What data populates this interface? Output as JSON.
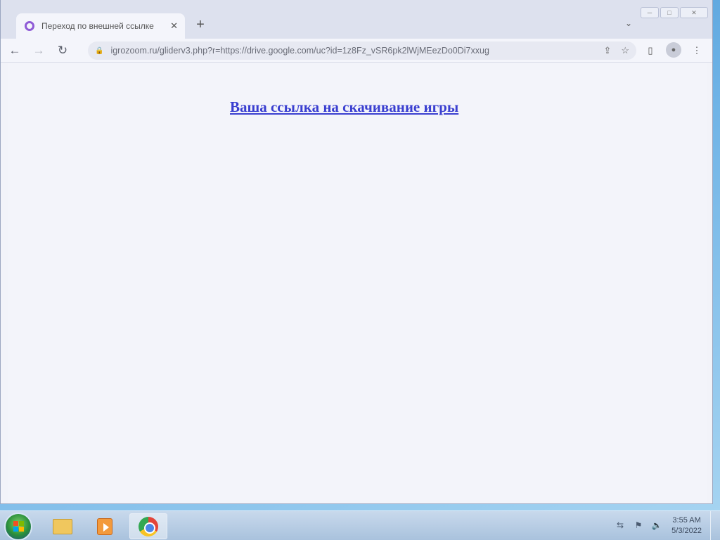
{
  "browser": {
    "tab": {
      "title": "Переход по внешней ссылке",
      "favicon": "opera-gx-icon",
      "close_glyph": "✕"
    },
    "new_tab_glyph": "+",
    "tab_search_glyph": "⌄",
    "window_controls": {
      "minimize": "─",
      "maximize": "□",
      "close": "✕"
    },
    "toolbar": {
      "back_glyph": "←",
      "forward_glyph": "→",
      "reload_glyph": "↻",
      "url": "igrozoom.ru/gliderv3.php?r=https://drive.google.com/uc?id=1z8Fz_vSR6pk2lWjMEezDo0Di7xxug",
      "share_glyph": "⇪",
      "bookmark_glyph": "☆",
      "sidepanel_glyph": "▯",
      "profile_glyph": "●",
      "menu_glyph": "⋮"
    }
  },
  "page": {
    "link_text": "Ваша ссылка на скачивание игры",
    "link_color": "#3a3fd0"
  },
  "taskbar": {
    "apps": [
      {
        "name": "windows-explorer",
        "active": false
      },
      {
        "name": "windows-media-player",
        "active": false
      },
      {
        "name": "google-chrome",
        "active": true
      }
    ],
    "tray_icons": [
      "network-icon",
      "action-center-icon",
      "volume-icon"
    ],
    "clock": {
      "time": "3:55 AM",
      "date": "5/3/2022"
    }
  }
}
